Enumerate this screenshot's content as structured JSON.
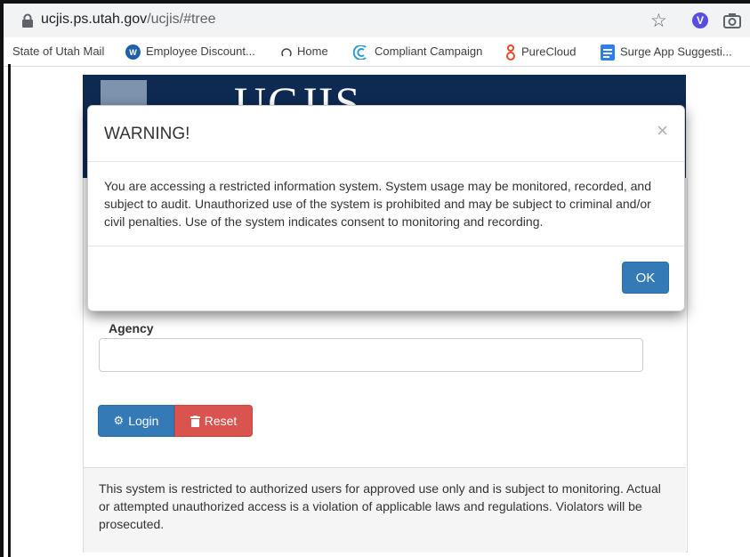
{
  "browser": {
    "url_host": "ucjis.ps.utah.gov",
    "url_path": "/ucjis/#tree",
    "ext_letter": "V"
  },
  "bookmarks": [
    {
      "label": "State of Utah Mail",
      "icon": "none"
    },
    {
      "label": "Employee Discount...",
      "icon": "employee-discount-icon"
    },
    {
      "label": "Home",
      "icon": "home-icon"
    },
    {
      "label": "Compliant Campaign",
      "icon": "campaign-icon"
    },
    {
      "label": "PureCloud",
      "icon": "purecloud-icon"
    },
    {
      "label": "Surge App Suggesti...",
      "icon": "doc-icon"
    }
  ],
  "banner": {
    "title": "UCJIS"
  },
  "form": {
    "agency_label": "Agency",
    "agency_value": ""
  },
  "buttons": {
    "login": "Login",
    "reset": "Reset"
  },
  "footer_notice": "This system is restricted to authorized users for approved use only and is subject to monitoring. Actual or attempted unauthorized access is a violation of applicable laws and regulations. Violators will be prosecuted.",
  "modal": {
    "title": "WARNING!",
    "close": "×",
    "body": "You are accessing a restricted information system. System usage may be monitored, recorded, and subject to audit. Unauthorized use of the system is prohibited and may be subject to criminal and/or civil penalties. Use of the system indicates consent to monitoring and recording.",
    "ok": "OK"
  },
  "colors": {
    "primary": "#337ab7",
    "danger": "#d9534f",
    "banner": "#0e2a52"
  }
}
